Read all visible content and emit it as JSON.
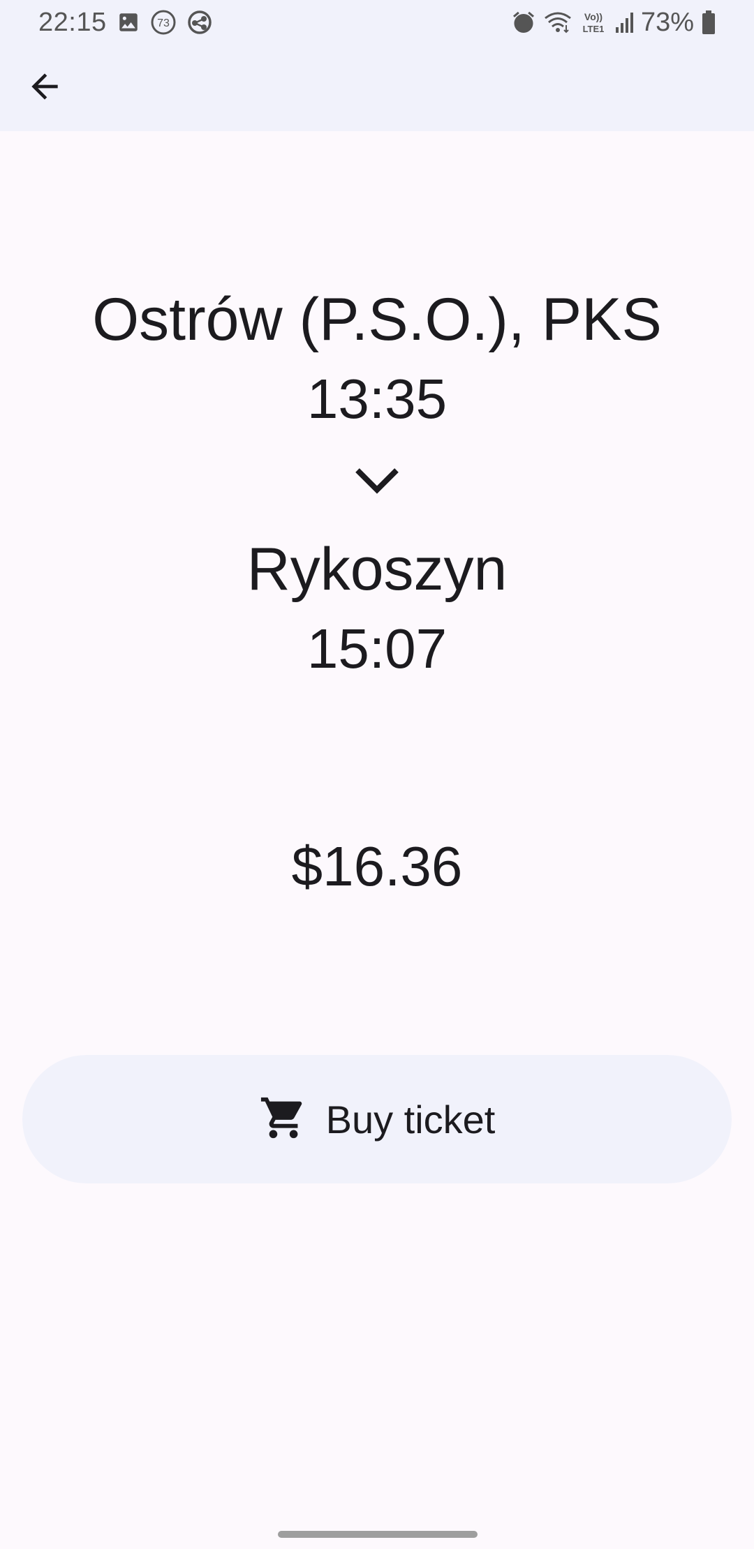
{
  "status_bar": {
    "time": "22:15",
    "notification_badge": "73",
    "battery": "73%",
    "network_label_top": "Vo))",
    "network_label_bottom": "LTE1",
    "icons": [
      "image-icon",
      "badge-73-icon",
      "sync-icon",
      "alarm-icon",
      "wifi-icon",
      "volte-icon",
      "signal-icon",
      "battery-icon"
    ]
  },
  "app_bar": {
    "back_icon": "arrow-back-icon"
  },
  "trip": {
    "origin": "Ostrów (P.S.O.), PKS",
    "departure_time": "13:35",
    "arrow_icon": "chevron-down-icon",
    "destination": "Rykoszyn",
    "arrival_time": "15:07",
    "price": "$16.36"
  },
  "actions": {
    "buy_label": "Buy ticket",
    "buy_icon": "cart-icon"
  },
  "colors": {
    "background": "#fdf9fd",
    "surface_tint": "#f1f2fb",
    "text": "#1c1b1f",
    "status_text": "#555555"
  }
}
